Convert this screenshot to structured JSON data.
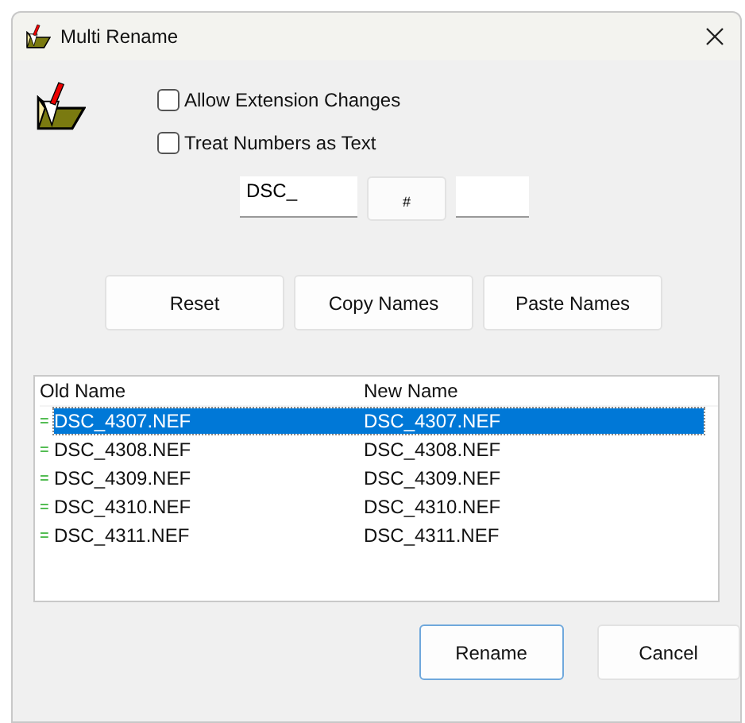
{
  "window": {
    "title": "Multi Rename"
  },
  "options": [
    {
      "label": "Allow Extension Changes",
      "checked": false
    },
    {
      "label": "Treat Numbers as Text",
      "checked": false
    }
  ],
  "pattern": {
    "prefix": "DSC_",
    "counter": "#"
  },
  "actions": [
    "Reset",
    "Copy Names",
    "Paste Names"
  ],
  "table": {
    "columns": [
      "Old Name",
      "New Name"
    ],
    "rows": [
      {
        "status": "=",
        "old": "DSC_4307.NEF",
        "new": "DSC_4307.NEF",
        "selected": true
      },
      {
        "status": "=",
        "old": "DSC_4308.NEF",
        "new": "DSC_4308.NEF",
        "selected": false
      },
      {
        "status": "=",
        "old": "DSC_4309.NEF",
        "new": "DSC_4309.NEF",
        "selected": false
      },
      {
        "status": "=",
        "old": "DSC_4310.NEF",
        "new": "DSC_4310.NEF",
        "selected": false
      },
      {
        "status": "=",
        "old": "DSC_4311.NEF",
        "new": "DSC_4311.NEF",
        "selected": false
      }
    ]
  },
  "buttons": [
    {
      "label": "Rename",
      "default": true
    },
    {
      "label": "Cancel",
      "default": false
    }
  ]
}
